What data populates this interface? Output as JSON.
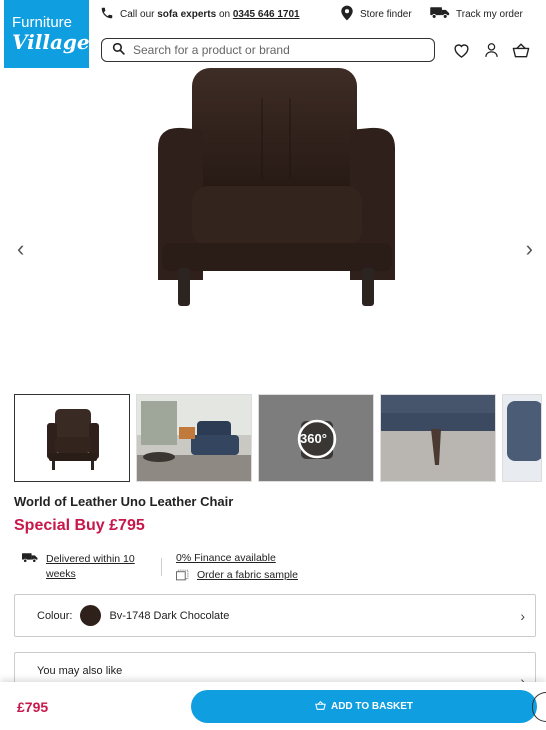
{
  "header": {
    "logo_line1": "Furniture",
    "logo_line2": "Village",
    "call_prefix": "Call our",
    "call_bold": "sofa experts",
    "call_on": "on",
    "phone": "0345 646 1701",
    "store_finder": "Store finder",
    "track_order": "Track my order",
    "search_placeholder": "Search for a product or brand"
  },
  "product": {
    "title": "World of Leather Uno Leather Chair",
    "special_label": "Special Buy",
    "price": "£795",
    "thumb_360": "360°"
  },
  "features": {
    "delivery": "Delivered within 10 weeks",
    "finance": "0% Finance available",
    "sample": "Order a fabric sample"
  },
  "colour": {
    "label": "Colour:",
    "value": "Bv-1748 Dark Chocolate",
    "swatch": "#2e201b"
  },
  "also_like": "You may also like",
  "bottom": {
    "price": "£795",
    "button": "ADD TO BASKET"
  },
  "colors": {
    "brand": "#0f9ee0",
    "price": "#c8174a"
  },
  "icons": [
    "phone-icon",
    "location-pin-icon",
    "truck-icon",
    "search-icon",
    "heart-icon",
    "user-icon",
    "basket-icon",
    "chevron-left-icon",
    "chevron-right-icon"
  ]
}
